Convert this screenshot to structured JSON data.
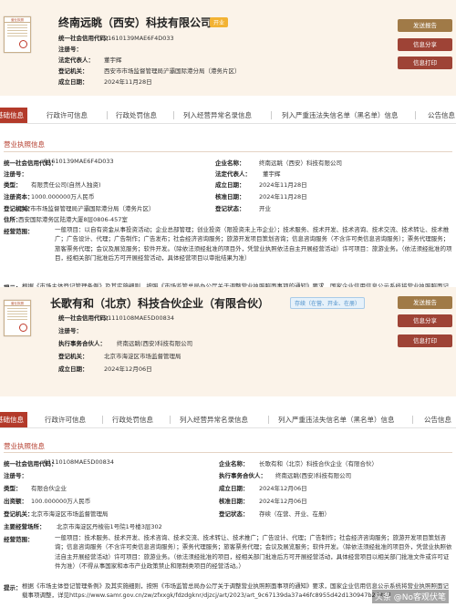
{
  "company1": {
    "name": "终南远眺（西安）科技有限公司",
    "status": "开业",
    "card": [
      {
        "label": "统一社会信用代码：",
        "value": "91610139MAE6F4D033"
      },
      {
        "label": "注册号：",
        "value": ""
      },
      {
        "label": "法定代表人：",
        "value": "董宇辉"
      },
      {
        "label": "登记机关：",
        "value": "西安市市场监督管理局浐灞国际港分局（港务片区）"
      },
      {
        "label": "成立日期：",
        "value": "2024年11月28日"
      }
    ],
    "buttons": {
      "report": "发送报告",
      "service": "信息分享",
      "print": "信息打印"
    },
    "tabs": [
      "基础信息",
      "行政许可信息",
      "行政处罚信息",
      "列入经营异常名录信息",
      "列入严重违法失信名单（黑名单）信息",
      "公告信息"
    ],
    "section_title": "营业执照信息",
    "left": [
      {
        "label": "统一社会信用代码：",
        "value": "91610139MAE6F4D033"
      },
      {
        "label": "注册号：",
        "value": ""
      },
      {
        "label": "类型：",
        "value": "有限责任公司(自然人独资)"
      },
      {
        "label": "注册资本：",
        "value": "1000.000000万人民币"
      },
      {
        "label": "登记机关：",
        "value": "西安市市场监督管理局浐灞国际港分局（港务片区）"
      },
      {
        "label": "住所：",
        "value": "西安国际港务区陆港大厦8层0806-457室"
      }
    ],
    "right": [
      {
        "label": "企业名称：",
        "value": "终南远眺（西安）科技有限公司"
      },
      {
        "label": "法定代表人：",
        "value": "董宇辉"
      },
      {
        "label": "成立日期：",
        "value": "2024年11月28日"
      },
      {
        "label": "核准日期：",
        "value": "2024年11月28日"
      },
      {
        "label": "登记状态：",
        "value": "开业"
      }
    ],
    "scope_label": "经营范围：",
    "scope": "一般项目：以自有资金从事投资活动；企业总部管理；创业投资（限投资未上市企业）；技术服务、技术开发、技术咨询、技术交流、技术转让、技术推广；广告设计、代理；广告制作；广告发布；社会经济咨询服务；旅游开发项目策划咨询；信息咨询服务（不含许可类信息咨询服务）；票务代理服务；旅客票务代理；会议及展览服务；软件开发。（除依法须经批准的项目外，凭营业执照依法自主开展经营活动）许可项目：旅游业务。（依法须经批准的项目，经相关部门批准后方可开展经营活动，具体经营项目以审批结果为准）",
    "note_label": "提示：",
    "note": "根据《市场主体登记管理条例》及其实施细则，按照《市场监管总局办公厅关于调整营业执照照面事项的通知》要求，国家企业信用信息公示系统将营业执照照面记载事项调整，详见https://www.samr.gov.cn/zw/zfxxgk/fdzdgknr/djzcj/art/2023/art_9c67139da37a46fc8955d42d130947b2.html"
  },
  "company2": {
    "name": "长歌有和（北京）科技合伙企业（有限合伙）",
    "status": "存续（在营、开业、在册）",
    "card": [
      {
        "label": "统一社会信用代码：",
        "value": "91110108MAE5D00834"
      },
      {
        "label": "注册号：",
        "value": ""
      },
      {
        "label": "执行事务合伙人：",
        "value": "终南远眺(西安)科技有限公司"
      },
      {
        "label": "登记机关：",
        "value": "北京市海淀区市场监督管理局"
      },
      {
        "label": "成立日期：",
        "value": "2024年12月06日"
      }
    ],
    "buttons": {
      "report": "发送报告",
      "service": "信息分享",
      "print": "信息打印"
    },
    "tabs": [
      "基础信息",
      "行政许可信息",
      "行政处罚信息",
      "列入经营异常名录信息",
      "列入严重违法失信名单（黑名单）信息",
      "公告信息"
    ],
    "section_title": "营业执照信息",
    "left": [
      {
        "label": "统一社会信用代码：",
        "value": "91110108MAE5D00834"
      },
      {
        "label": "注册号：",
        "value": ""
      },
      {
        "label": "类型：",
        "value": "有限合伙企业"
      },
      {
        "label": "出资额：",
        "value": "100.000000万人民币"
      },
      {
        "label": "登记机关：",
        "value": "北京市海淀区市场监督管理局"
      },
      {
        "label": "主要经营场所：",
        "value": "北京市海淀区丹棱街1号院1号楼3层302"
      }
    ],
    "right": [
      {
        "label": "企业名称：",
        "value": "长歌有和（北京）科技合伙企业（有限合伙）"
      },
      {
        "label": "执行事务合伙人：",
        "value": "终南远眺(西安)科技有限公司"
      },
      {
        "label": "成立日期：",
        "value": "2024年12月06日"
      },
      {
        "label": "核准日期：",
        "value": "2024年12月06日"
      },
      {
        "label": "登记状态：",
        "value": "存续（在营、开业、在册）"
      }
    ],
    "scope_label": "经营范围：",
    "scope": "一般项目：技术服务、技术开发、技术咨询、技术交流、技术转让、技术推广；广告设计、代理；广告制作；社会经济咨询服务；旅游开发项目策划咨询；信息咨询服务（不含许可类信息咨询服务）；票务代理服务；旅客票务代理；会议及展览服务；软件开发。（除依法须经批准的项目外，凭营业执照依法自主开展经营活动）许可项目：旅游业务。（依法须经批准的项目，经相关部门批准后方可开展经营活动，具体经营项目以相关部门批准文件或许可证件为准）（不得从事国家和本市产业政策禁止和限制类项目的经营活动。）",
    "note_label": "提示：",
    "note": "根据《市场主体登记管理条例》及其实施细则，按照《市场监管总局办公厅关于调整营业执照照面事项的通知》要求，国家企业信用信息公示系统将营业执照照面记载事项调整，详见https://www.samr.gov.cn/zw/zfxxgk/fdzdgknr/djzcj/art/2023/art_9c67139da37a46fc8955d42d130947b2.html"
  },
  "thumb_title": "营业执照",
  "watermark": "头条 @No客观伏笔"
}
